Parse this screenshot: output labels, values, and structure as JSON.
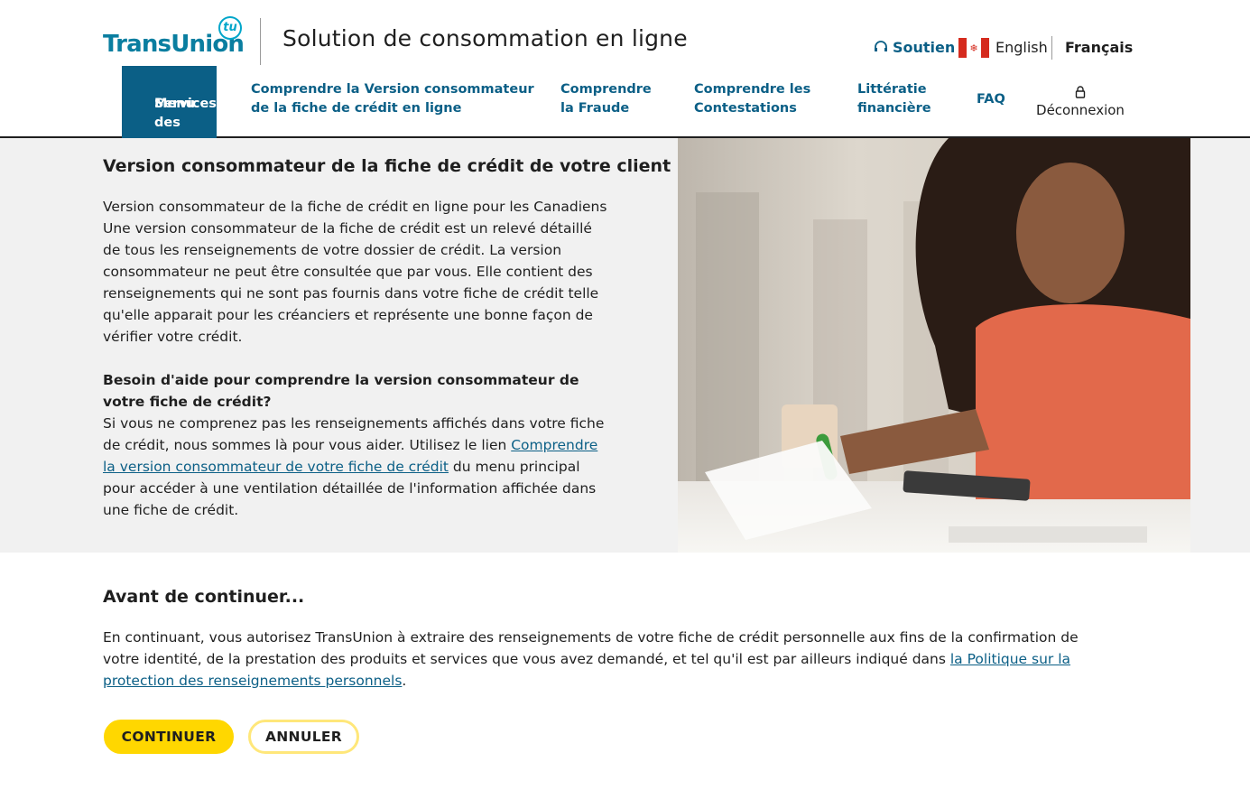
{
  "brand": {
    "logo_text": "TransUnion",
    "logo_badge": "tu",
    "accent": "#0b5f86",
    "logo_color": "#00a6ca"
  },
  "header": {
    "app_title": "Solution de consommation en ligne"
  },
  "utility": {
    "support": "Soutien",
    "english": "English",
    "french": "Français"
  },
  "nav": {
    "items": [
      {
        "line1": "Menu des",
        "line2": "Services",
        "active": true
      },
      {
        "line1": "Comprendre la Version consommateur",
        "line2": "de la fiche de crédit en ligne"
      },
      {
        "line1": "Comprendre",
        "line2": "la Fraude"
      },
      {
        "line1": "Comprendre les",
        "line2": "Contestations"
      },
      {
        "line1": "Littératie",
        "line2": "financière"
      },
      {
        "line1": "FAQ"
      }
    ],
    "logout": "Déconnexion"
  },
  "hero": {
    "title": "Version consommateur de la fiche de crédit de votre client",
    "para1": "Version consommateur de la fiche de crédit en ligne pour les Canadiens Une version consommateur de la fiche de crédit est un relevé détaillé de tous les renseignements de votre dossier de crédit. La version consommateur ne peut être consultée que par vous. Elle contient des renseignements qui ne sont pas fournis dans votre fiche de crédit telle qu'elle apparait pour les créanciers et représente une bonne façon de vérifier votre crédit.",
    "help_title": "Besoin d'aide pour comprendre la version consommateur de votre fiche de crédit?",
    "help_before": "Si vous ne comprenez pas les renseignements affichés dans votre fiche de crédit, nous sommes là pour vous aider. Utilisez le lien ",
    "help_link": "Comprendre la version consommateur de votre fiche de crédit",
    "help_after": " du menu principal pour accéder à une ventilation détaillée de l'information affichée dans une fiche de crédit."
  },
  "notice": {
    "title": "Avant de continuer...",
    "before": "En continuant, vous autorisez TransUnion à extraire des renseignements de votre fiche de crédit personnelle aux fins de la confirmation de votre identité, de la prestation des produits et services que vous avez demandé, et tel qu'il est par ailleurs indiqué dans ",
    "link": "la Politique sur la protection des renseignements personnels",
    "after": "."
  },
  "buttons": {
    "continue": "CONTINUER",
    "cancel": "ANNULER"
  }
}
